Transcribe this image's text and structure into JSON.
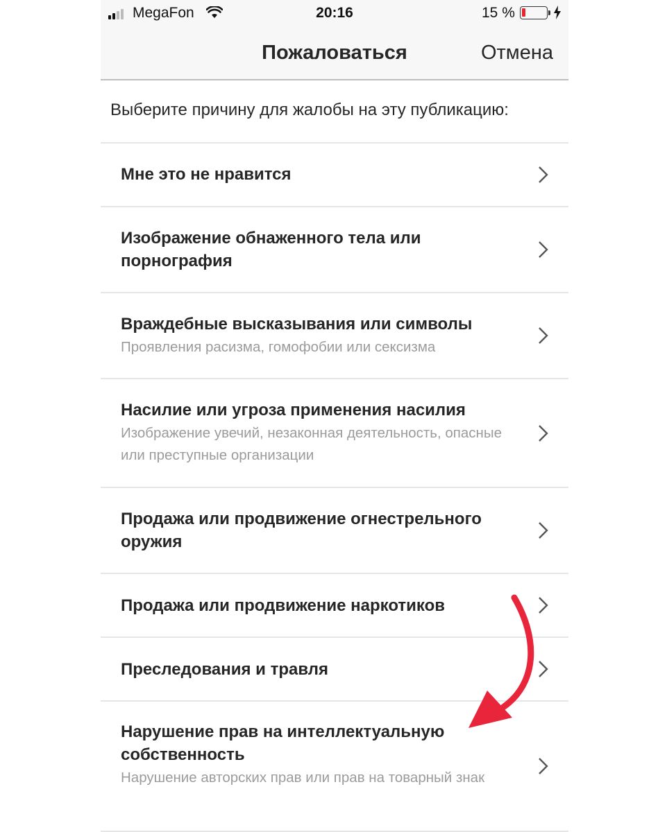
{
  "status_bar": {
    "carrier": "MegaFon",
    "time": "20:16",
    "battery_percent": "15 %",
    "battery_level": 0.15,
    "battery_color": "#e8252f",
    "icons": [
      "signal-icon",
      "wifi-icon",
      "battery-icon",
      "charging-icon"
    ]
  },
  "nav": {
    "title": "Пожаловаться",
    "cancel": "Отмена"
  },
  "prompt": "Выберите причину для жалобы на эту публикацию:",
  "options": [
    {
      "title": "Мне это не нравится",
      "subtitle": ""
    },
    {
      "title": "Изображение обнаженного тела или порнография",
      "subtitle": ""
    },
    {
      "title": "Враждебные высказывания или символы",
      "subtitle": "Проявления расизма, гомофобии или сексизма"
    },
    {
      "title": "Насилие или угроза применения насилия",
      "subtitle": "Изображение увечий, незаконная деятельность, опасные или преступные организации"
    },
    {
      "title": "Продажа или продвижение огнестрельного оружия",
      "subtitle": ""
    },
    {
      "title": "Продажа или продвижение наркотиков",
      "subtitle": ""
    },
    {
      "title": "Преследования и травля",
      "subtitle": ""
    },
    {
      "title": "Нарушение прав на интеллектуальную собственность",
      "subtitle": "Нарушение авторских прав или прав на товарный знак"
    }
  ],
  "annotation": {
    "arrow_color": "#e8253a",
    "icon": "red-arrow-icon"
  }
}
